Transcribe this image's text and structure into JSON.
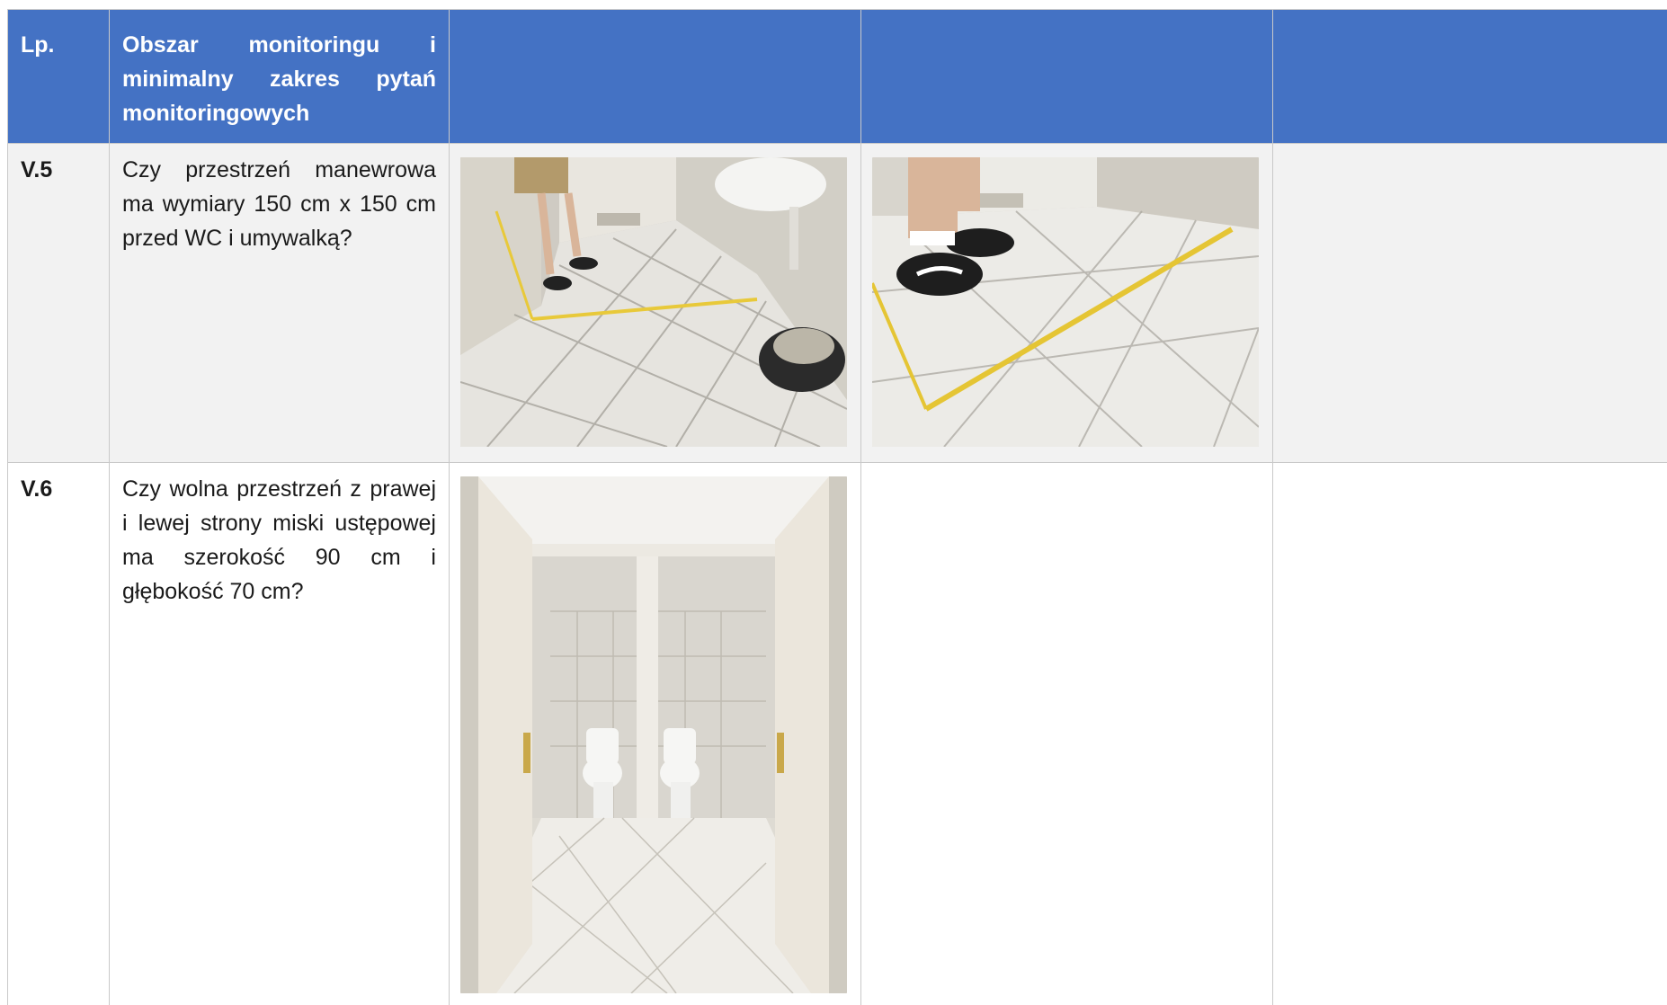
{
  "header": {
    "lp": "Lp.",
    "area": "Obszar monitoringu i minimalny zakres pytań monitoringowych",
    "col3": "",
    "col4": "",
    "col5": ""
  },
  "rows": [
    {
      "lp": "V.5",
      "question": "Czy przestrzeń manewrowa ma wymiary 150 cm x 150 cm przed WC i umywalką?",
      "photos": [
        "bathroom-floor-measuring-tape-photo",
        "floor-tape-close-up-photo"
      ]
    },
    {
      "lp": "V.6",
      "question": "Czy wolna przestrzeń z prawej i lewej strony miski ustępowej ma szerokość 90 cm i głębokość 70 cm?",
      "photos": [
        "toilet-stalls-photo"
      ]
    }
  ],
  "colors": {
    "header_bg": "#4472c4",
    "header_text": "#ffffff",
    "body_grey": "#f2f2f2",
    "border": "#c9c9c9"
  }
}
